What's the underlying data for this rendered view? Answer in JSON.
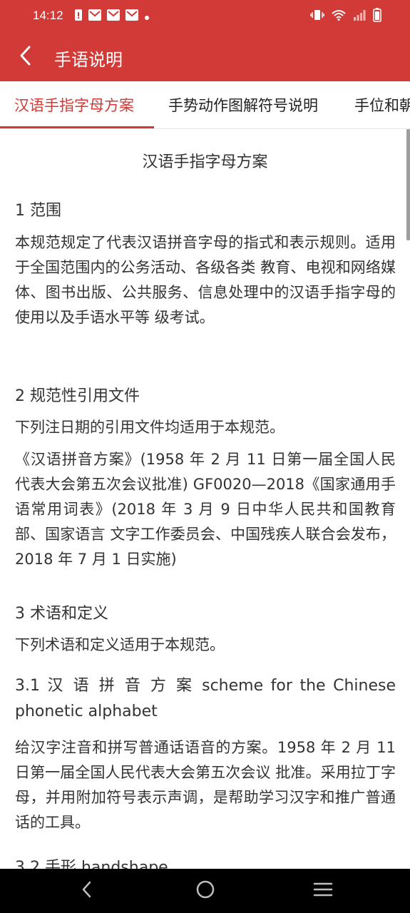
{
  "status_bar": {
    "time": "14:12",
    "left_icons": [
      "sim-alert-icon",
      "mail-icon",
      "mail-icon",
      "mail-icon",
      "dot-icon"
    ],
    "right_icons": [
      "vibrate-icon",
      "wifi-icon",
      "signal-icon",
      "battery-icon"
    ]
  },
  "header": {
    "title": "手语说明",
    "back_icon": "chevron-left-icon"
  },
  "tabs": [
    {
      "label": "汉语手指字母方案",
      "active": true
    },
    {
      "label": "手势动作图解符号说明",
      "active": false
    },
    {
      "label": "手位和朝",
      "active": false
    }
  ],
  "document": {
    "title": "汉语手指字母方案",
    "s1_heading": "1 范围",
    "s1_text": "本规范规定了代表汉语拼音字母的指式和表示规则。适用于全国范围内的公务活动、各级各类 教育、电视和网络媒体、图书出版、公共服务、信息处理中的汉语手指字母的使用以及手语水平等 级考试。",
    "s2_heading": "2 规范性引用文件",
    "s2_text1": "下列注日期的引用文件均适用于本规范。",
    "s2_text2": "《汉语拼音方案》(1958 年 2 月 11 日第一届全国人民代表大会第五次会议批准) GF0020—2018《国家通用手语常用词表》(2018 年 3 月 9 日中华人民共和国教育部、国家语言 文字工作委员会、中国残疾人联合会发布，2018 年 7 月 1 日实施)",
    "s3_heading": "3 术语和定义",
    "s3_text": "下列术语和定义适用于本规范。",
    "s31_heading": "3.1 汉 语 拼 音 方 案  scheme for the Chinese phonetic alphabet",
    "s31_text": "给汉字注音和拼写普通话语音的方案。1958 年 2 月 11 日第一届全国人民代表大会第五次会议 批准。采用拉丁字母，并用附加符号表示声调，是帮助学习汉字和推广普通话的工具。",
    "s32_heading": "3.2 手形 handshape"
  },
  "nav_bar": {
    "buttons": [
      "back-nav-icon",
      "home-nav-icon",
      "recents-nav-icon"
    ]
  },
  "colors": {
    "accent": "#d13a36",
    "text": "#333333",
    "nav_bar": "#000000"
  }
}
